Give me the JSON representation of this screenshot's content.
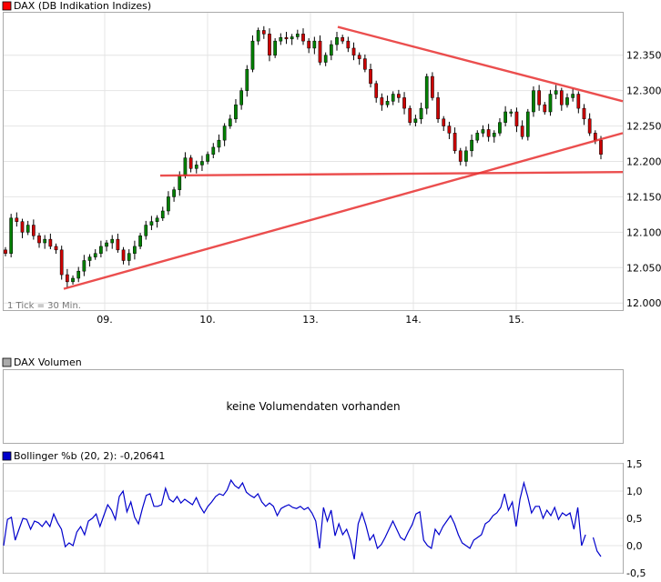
{
  "price_panel": {
    "legend": "DAX (DB Indikation Indizes)",
    "legend_color": "#ff0000",
    "tick_note": "1 Tick = 30 Min."
  },
  "volume_panel": {
    "legend": "DAX Volumen",
    "legend_color": "#aaaaaa",
    "message": "keine Volumendaten vorhanden"
  },
  "indicator_panel": {
    "legend": "Bollinger %b (20, 2): -0,20641",
    "legend_color": "#0000cc"
  },
  "chart_data": [
    {
      "type": "candlestick",
      "title": "DAX (DB Indikation Indizes)",
      "interval": "30 Min.",
      "x_ticks": [
        "09.",
        "10.",
        "13.",
        "14.",
        "15."
      ],
      "y_ticks": [
        "12.000",
        "12.050",
        "12.100",
        "12.150",
        "12.200",
        "12.250",
        "12.300",
        "12.350"
      ],
      "ylim": [
        11990,
        12410
      ],
      "grid": true,
      "colors": {
        "up": "#008000",
        "down": "#cc0000",
        "trendline": "#e83030"
      },
      "closes": [
        12070,
        12120,
        12115,
        12100,
        12110,
        12095,
        12085,
        12090,
        12080,
        12075,
        12040,
        12030,
        12035,
        12045,
        12060,
        12065,
        12070,
        12080,
        12085,
        12090,
        12075,
        12060,
        12070,
        12080,
        12095,
        12110,
        12115,
        12120,
        12130,
        12150,
        12160,
        12180,
        12205,
        12190,
        12195,
        12200,
        12210,
        12220,
        12230,
        12250,
        12260,
        12280,
        12300,
        12330,
        12370,
        12385,
        12380,
        12350,
        12370,
        12375,
        12373,
        12376,
        12380,
        12370,
        12360,
        12370,
        12340,
        12350,
        12365,
        12375,
        12370,
        12360,
        12350,
        12345,
        12330,
        12310,
        12290,
        12280,
        12285,
        12295,
        12290,
        12275,
        12255,
        12260,
        12275,
        12320,
        12290,
        12260,
        12250,
        12240,
        12215,
        12200,
        12215,
        12230,
        12240,
        12245,
        12235,
        12240,
        12255,
        12270,
        12270,
        12250,
        12235,
        12270,
        12300,
        12280,
        12270,
        12295,
        12300,
        12280,
        12290,
        12295,
        12275,
        12260,
        12240,
        12230,
        12210
      ],
      "trendlines": [
        {
          "from": [
            1,
            12020
          ],
          "to": [
            14,
            12240
          ]
        },
        {
          "from": [
            3.65,
            12180
          ],
          "to": [
            14,
            12185
          ]
        },
        {
          "from": [
            3.3,
            12390
          ],
          "to": [
            14,
            12285
          ]
        }
      ]
    },
    {
      "type": "line",
      "title": "Bollinger %b (20, 2): -0,20641",
      "y_ticks": [
        "-0,5",
        "0,0",
        "0,5",
        "1,0",
        "1,5"
      ],
      "ylim": [
        -0.5,
        1.5
      ],
      "last_value": -0.20641,
      "color": "#0000cc",
      "values": [
        0.0,
        0.48,
        0.52,
        0.1,
        0.3,
        0.5,
        0.48,
        0.3,
        0.45,
        0.42,
        0.35,
        0.45,
        0.35,
        0.58,
        0.42,
        0.3,
        -0.02,
        0.05,
        0.0,
        0.25,
        0.35,
        0.2,
        0.45,
        0.5,
        0.58,
        0.35,
        0.55,
        0.75,
        0.65,
        0.48,
        0.9,
        1.0,
        0.62,
        0.8,
        0.52,
        0.4,
        0.68,
        0.92,
        0.95,
        0.72,
        0.72,
        0.75,
        1.05,
        0.85,
        0.8,
        0.9,
        0.78,
        0.85,
        0.8,
        0.75,
        0.88,
        0.72,
        0.6,
        0.72,
        0.8,
        0.9,
        0.95,
        0.92,
        1.02,
        1.2,
        1.1,
        1.05,
        1.15,
        0.98,
        0.92,
        0.88,
        0.95,
        0.8,
        0.72,
        0.78,
        0.72,
        0.55,
        0.68,
        0.72,
        0.75,
        0.7,
        0.68,
        0.72,
        0.66,
        0.7,
        0.6,
        0.45,
        -0.05,
        0.7,
        0.45,
        0.65,
        0.18,
        0.4,
        0.2,
        0.3,
        0.1,
        -0.25,
        0.4,
        0.6,
        0.38,
        0.1,
        0.2,
        -0.05,
        0.02,
        0.15,
        0.3,
        0.45,
        0.3,
        0.15,
        0.1,
        0.25,
        0.38,
        0.58,
        0.62,
        0.1,
        0.0,
        -0.05,
        0.3,
        0.2,
        0.35,
        0.45,
        0.55,
        0.4,
        0.2,
        0.05,
        0.0,
        -0.05,
        0.1,
        0.15,
        0.2,
        0.4,
        0.45,
        0.55,
        0.6,
        0.7,
        0.95,
        0.65,
        0.8,
        0.35,
        0.85,
        1.15,
        0.9,
        0.6,
        0.72,
        0.72,
        0.5,
        0.65,
        0.55,
        0.7,
        0.48,
        0.6,
        0.55,
        0.6,
        0.3,
        0.7,
        0.0,
        0.2,
        null,
        0.15,
        -0.1,
        -0.2
      ]
    }
  ]
}
